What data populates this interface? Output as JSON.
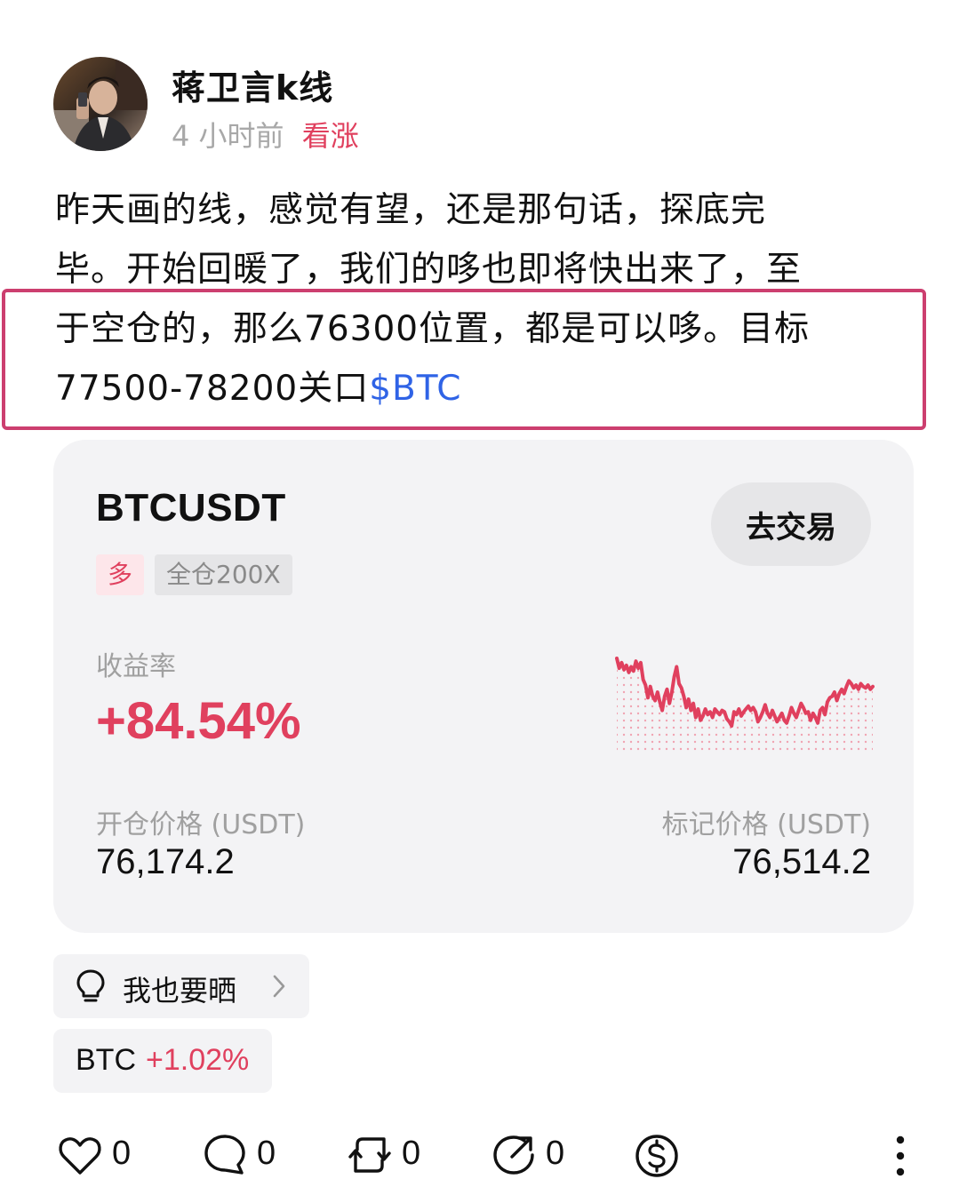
{
  "author": {
    "name": "蒋卫言k线",
    "time_ago": "4 小时前",
    "sentiment": "看涨"
  },
  "post": {
    "lines": [
      "昨天画的线，感觉有望，还是那句话，探底完",
      "毕。开始回暖了，我们的哆也即将快出来了，至",
      "于空仓的，那么76300位置，都是可以哆。目标",
      "77500-78200关口"
    ],
    "cashtag": "$BTC"
  },
  "trade_card": {
    "symbol": "BTCUSDT",
    "go_trade_label": "去交易",
    "side_tag": "多",
    "margin_tag": "全仓200X",
    "roi_label": "收益率",
    "roi_value": "+84.54%",
    "open_price_label": "开仓价格 (USDT)",
    "open_price_value": "76,174.2",
    "mark_price_label": "标记价格 (USDT)",
    "mark_price_value": "76,514.2",
    "sparkline_color": "#e0405e"
  },
  "chart_data": {
    "type": "line",
    "title": "",
    "xlabel": "",
    "ylabel": "",
    "grid": false,
    "series": [
      {
        "values": [
          100,
          86,
          94,
          84,
          90,
          80,
          88,
          82,
          96,
          86,
          94,
          70,
          62,
          44,
          60,
          46,
          40,
          52,
          38,
          26,
          46,
          56,
          36,
          52,
          74,
          88,
          64,
          58,
          46,
          30,
          42,
          26,
          36,
          16,
          28,
          12,
          18,
          28,
          20,
          24,
          16,
          28,
          24,
          20,
          26,
          24,
          14,
          10,
          4,
          24,
          20,
          28,
          18,
          24,
          28,
          32,
          26,
          30,
          24,
          10,
          16,
          24,
          34,
          22,
          16,
          26,
          18,
          10,
          16,
          22,
          12,
          8,
          18,
          30,
          22,
          16,
          26,
          36,
          30,
          22,
          24,
          12,
          22,
          16,
          8,
          26,
          30,
          20,
          38,
          44,
          46,
          52,
          40,
          50,
          56,
          50,
          60,
          68,
          64,
          58,
          62,
          56,
          64,
          60,
          58,
          62,
          56,
          60
        ]
      }
    ]
  },
  "share_chip": {
    "label": "我也要晒",
    "icon": "lightbulb-icon"
  },
  "coin_chip": {
    "coin": "BTC",
    "change": "+1.02%"
  },
  "actions": {
    "like_count": "0",
    "comment_count": "0",
    "repost_count": "0",
    "share_count": "0",
    "icons": [
      "heart-icon",
      "comment-icon",
      "repost-icon",
      "share-icon",
      "tip-dollar-icon",
      "more-vertical-icon"
    ]
  }
}
